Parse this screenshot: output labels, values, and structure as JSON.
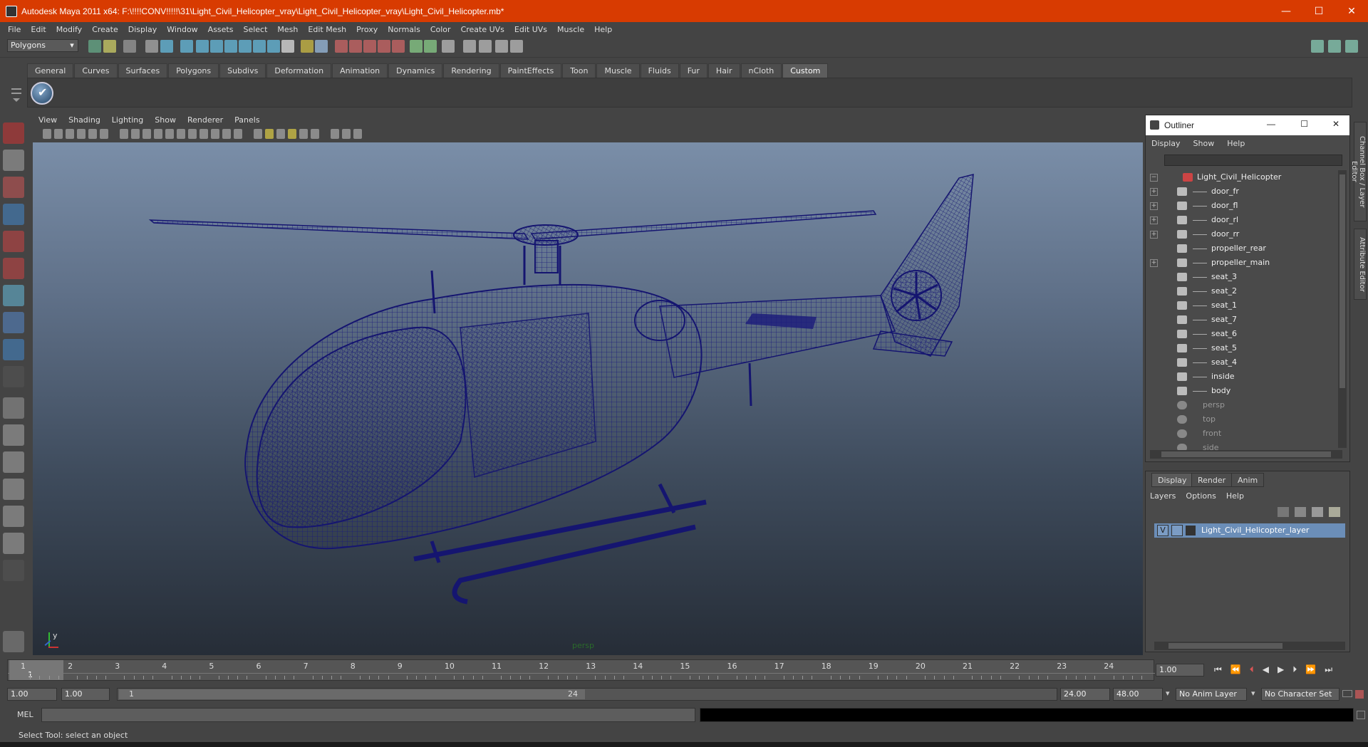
{
  "window": {
    "title": "Autodesk Maya 2011 x64: F:\\!!!!CONV!!!!!\\31\\Light_Civil_Helicopter_vray\\Light_Civil_Helicopter_vray\\Light_Civil_Helicopter.mb*",
    "minimize": "—",
    "maximize": "☐",
    "close": "✕"
  },
  "menubar": [
    "File",
    "Edit",
    "Modify",
    "Create",
    "Display",
    "Window",
    "Assets",
    "Select",
    "Mesh",
    "Edit Mesh",
    "Proxy",
    "Normals",
    "Color",
    "Create UVs",
    "Edit UVs",
    "Muscle",
    "Help"
  ],
  "statusline": {
    "mode": "Polygons"
  },
  "shelf_tabs": [
    {
      "label": "General"
    },
    {
      "label": "Curves"
    },
    {
      "label": "Surfaces"
    },
    {
      "label": "Polygons"
    },
    {
      "label": "Subdivs"
    },
    {
      "label": "Deformation"
    },
    {
      "label": "Animation"
    },
    {
      "label": "Dynamics"
    },
    {
      "label": "Rendering"
    },
    {
      "label": "PaintEffects"
    },
    {
      "label": "Toon"
    },
    {
      "label": "Muscle"
    },
    {
      "label": "Fluids"
    },
    {
      "label": "Fur"
    },
    {
      "label": "Hair"
    },
    {
      "label": "nCloth"
    },
    {
      "label": "Custom",
      "active": true
    }
  ],
  "viewport": {
    "menu": [
      "View",
      "Shading",
      "Lighting",
      "Show",
      "Renderer",
      "Panels"
    ],
    "camera_label": "persp",
    "axis_y": "y",
    "wire_color": "#1a1a7a"
  },
  "outliner": {
    "title": "Outliner",
    "menu": [
      "Display",
      "Show",
      "Help"
    ],
    "items": [
      {
        "label": "Light_Civil_Helicopter",
        "exp": "−",
        "root": true
      },
      {
        "label": "door_fr",
        "exp": "+"
      },
      {
        "label": "door_fl",
        "exp": "+"
      },
      {
        "label": "door_rl",
        "exp": "+"
      },
      {
        "label": "door_rr",
        "exp": "+"
      },
      {
        "label": "propeller_rear",
        "exp": ""
      },
      {
        "label": "propeller_main",
        "exp": "+"
      },
      {
        "label": "seat_3",
        "exp": ""
      },
      {
        "label": "seat_2",
        "exp": ""
      },
      {
        "label": "seat_1",
        "exp": ""
      },
      {
        "label": "seat_7",
        "exp": ""
      },
      {
        "label": "seat_6",
        "exp": ""
      },
      {
        "label": "seat_5",
        "exp": ""
      },
      {
        "label": "seat_4",
        "exp": ""
      },
      {
        "label": "inside",
        "exp": ""
      },
      {
        "label": "body",
        "exp": ""
      },
      {
        "label": "persp",
        "exp": "",
        "camera": true
      },
      {
        "label": "top",
        "exp": "",
        "camera": true
      },
      {
        "label": "front",
        "exp": "",
        "camera": true
      },
      {
        "label": "side",
        "exp": "",
        "camera": true
      }
    ]
  },
  "layers": {
    "tabs": [
      {
        "label": "Display",
        "active": true
      },
      {
        "label": "Render"
      },
      {
        "label": "Anim"
      }
    ],
    "menu": [
      "Layers",
      "Options",
      "Help"
    ],
    "layer_name": "Light_Civil_Helicopter_layer",
    "visibility": "V"
  },
  "side_tabs": [
    "Channel Box / Layer Editor",
    "Attribute Editor"
  ],
  "timeline": {
    "ticks": [
      "1",
      "2",
      "3",
      "4",
      "5",
      "6",
      "7",
      "8",
      "9",
      "10",
      "11",
      "12",
      "13",
      "14",
      "15",
      "16",
      "17",
      "18",
      "19",
      "20",
      "21",
      "22",
      "23",
      "24"
    ],
    "current_frame": "1",
    "current_time_field": "1.00"
  },
  "range": {
    "start_time": "1.00",
    "playback_start": "1.00",
    "slider_start": "1",
    "slider_end": "24",
    "playback_end": "24.00",
    "end_time": "48.00",
    "anim_layer": "No Anim Layer",
    "character_set": "No Character Set"
  },
  "cmdline": {
    "label": "MEL"
  },
  "helpline": {
    "text": "Select Tool: select an object"
  }
}
